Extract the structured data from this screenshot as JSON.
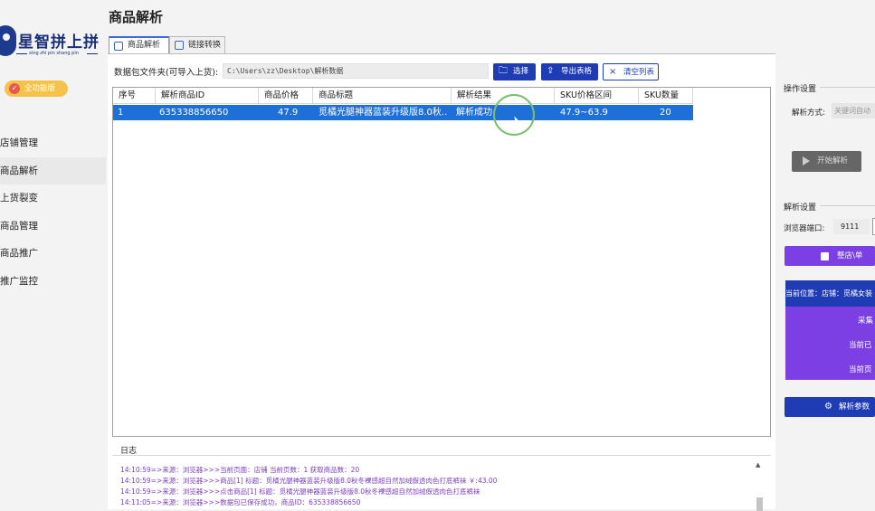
{
  "app": {
    "logo_title": "星智拼上拼",
    "logo_sub": "xing zhi pin shang pin",
    "badge": "全功能版"
  },
  "sidebar": {
    "items": [
      {
        "label": "店铺管理"
      },
      {
        "label": "商品解析"
      },
      {
        "label": "上货裂变"
      },
      {
        "label": "商品管理"
      },
      {
        "label": "商品推广"
      },
      {
        "label": "推广监控"
      }
    ]
  },
  "main": {
    "title": "商品解析",
    "tabs": [
      {
        "label": "商品解析"
      },
      {
        "label": "链接转换"
      }
    ],
    "path_label": "数据包文件夹(可导入上货):",
    "path_value": "C:\\Users\\zz\\Desktop\\解析数据",
    "buttons": {
      "select": "选择",
      "export": "导出表格",
      "clear": "清空列表"
    }
  },
  "table": {
    "columns": [
      "序号",
      "解析商品ID",
      "商品价格",
      "商品标题",
      "解析结果",
      "SKU价格区间",
      "SKU数量"
    ],
    "rows": [
      {
        "index": "1",
        "id": "635338856650",
        "price": "47.9",
        "title": "觅橘光腿神器蓝装升级版8.0秋...",
        "result": "解析成功",
        "sku_range": "47.9~63.9",
        "sku_count": "20"
      }
    ]
  },
  "log": {
    "title": "日志",
    "lines": [
      "14:10:59=>来源：浏览器>>>当前页面：店铺 当前页数：1 获取商品数：20",
      "14:10:59=>来源：浏览器>>>商品[1] 标题：觅橘光腿神器蓝装升级版8.0秋冬裸感超自然加绒假透肉色打底裤袜 ￥:43.00",
      "14:10:59=>来源：浏览器>>>点击商品[1] 标题：觅橘光腿神器蓝装升级版8.0秋冬裸感超自然加绒假透肉色打底裤袜",
      "14:11:05=>来源：浏览器>>>数据包已保存成功，商品ID：635338856650"
    ]
  },
  "right": {
    "op_title": "操作设置",
    "method_label": "解析方式:",
    "method_value": "关键词自动",
    "start_label": "开始解析",
    "parse_title": "解析设置",
    "port_label": "浏览器端口:",
    "port_value": "9111",
    "store_btn": "整店\\单",
    "card_head": "当前位置：店铺：觅橘女装",
    "card_rows": [
      "采集",
      "当前已",
      "当前页"
    ],
    "params_btn": "解析参数"
  },
  "colors": {
    "accent_blue": "#1f3cb4",
    "selection_blue": "#1e6fd8",
    "purple": "#7b3fe4",
    "log_text": "#7b3fbf",
    "badge_yellow": "#f5c24a"
  },
  "icons": {
    "badge": "shield-check-icon",
    "tab_parse": "search-doc-icon",
    "tab_link": "link-edit-icon",
    "select": "folder-icon",
    "export": "upload-icon",
    "clear": "close-icon",
    "start": "play-icon",
    "store": "checkbox-icon",
    "params": "gear-icon"
  }
}
